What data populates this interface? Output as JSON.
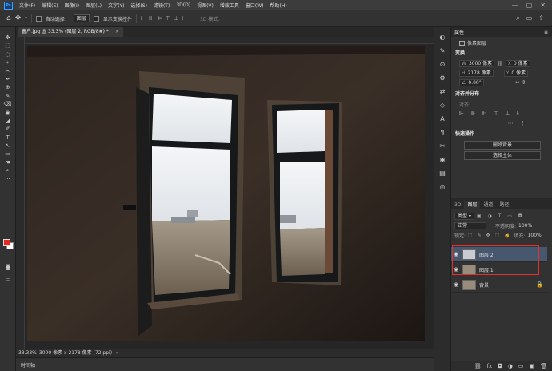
{
  "app": {
    "logo": "Ps"
  },
  "menu": [
    "文件(F)",
    "编辑(E)",
    "图像(I)",
    "图层(L)",
    "文字(Y)",
    "选择(S)",
    "滤镜(T)",
    "3D(D)",
    "视图(V)",
    "增效工具",
    "窗口(W)",
    "帮助(H)"
  ],
  "window_controls": {
    "minimize": "—",
    "maximize": "▢",
    "close": "✕"
  },
  "options": {
    "auto_select_label": "自动选择：",
    "auto_select_value": "图层",
    "show_transform_label": "显示变换控件",
    "align_icons": "⊩ ⊪ ⊫ ⊤ ⊥ ⊦ ··· ",
    "mode_3d": "3D 模式："
  },
  "tools": [
    "✥",
    "⬚",
    "◌",
    "⌖",
    "✂",
    "✒",
    "⊕",
    "✎",
    "⌫",
    "◉",
    "◢",
    "✐",
    "T",
    "↖",
    "▭",
    "☚",
    "⌕",
    "···"
  ],
  "document": {
    "tab_title": "窗户.jpg @ 33.3% (图层 2, RGB/8#) *",
    "close": "×"
  },
  "status": {
    "zoom": "33.33%",
    "info": "3000 像素 x 2178 像素 (72 ppi)",
    "arrow": "›"
  },
  "timeline": {
    "label": "时间轴"
  },
  "dock_icons": [
    "◐",
    "✎",
    "⊙",
    "⚙",
    "⇄",
    "◇",
    "A",
    "¶",
    "✂",
    "◉",
    "▤",
    "◎"
  ],
  "properties": {
    "title": "属性",
    "layer_type": "像素图层",
    "transform_title": "变换",
    "w_label": "W",
    "w_value": "3000 像素",
    "h_label": "H",
    "h_value": "2178 像素",
    "x_label": "X",
    "x_value": "0 像素",
    "y_label": "Y",
    "y_value": "0 像素",
    "angle_value": "0.00°",
    "align_title": "对齐并分布",
    "align_label": "对齐:",
    "quick_title": "快速操作",
    "remove_bg": "删除背景",
    "select_subject": "选择主体"
  },
  "layers_panel": {
    "tabs": [
      "3D",
      "图层",
      "通道",
      "路径"
    ],
    "filter_label": "类型",
    "blend_mode": "正常",
    "opacity_label": "不透明度:",
    "opacity_value": "100%",
    "lock_label": "锁定:",
    "fill_label": "填充:",
    "fill_value": "100%",
    "layers": [
      {
        "name": "图层 2"
      },
      {
        "name": "图层 1"
      },
      {
        "name": "背景"
      }
    ],
    "footer_icons": [
      "⛓",
      "fx",
      "◘",
      "◑",
      "▭",
      "▣",
      "🗑"
    ]
  }
}
